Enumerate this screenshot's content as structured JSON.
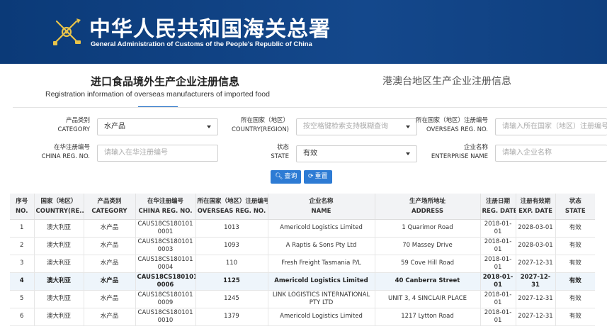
{
  "header": {
    "title_cn": "中华人民共和国海关总署",
    "title_en": "General Administration of Customs of the People's Republic of China",
    "emblem": "customs-emblem-icon",
    "bg_color": "#0e3d7a"
  },
  "tabs": {
    "active_cn": "进口食品境外生产企业注册信息",
    "active_en": "Registration information of overseas manufacturers of imported food",
    "other_cn": "港澳台地区生产企业注册信息"
  },
  "form": {
    "category": {
      "label_cn": "产品类别",
      "label_en": "CATEGORY",
      "value": "水产品"
    },
    "country": {
      "label_cn": "所在国家（地区）",
      "label_en": "COUNTRY(REGION)",
      "placeholder": "按空格键检索支持模糊查询"
    },
    "overseas_reg": {
      "label_cn": "所在国家（地区）注册编号",
      "label_en": "OVERSEAS REG. NO.",
      "placeholder": "请输入所在国家（地区）注册编号"
    },
    "china_reg": {
      "label_cn": "在华注册编号",
      "label_en": "CHINA REG. NO.",
      "placeholder": "请输入在华注册编号"
    },
    "state": {
      "label_cn": "状态",
      "label_en": "STATE",
      "value": "有效"
    },
    "enterprise": {
      "label_cn": "企业名称",
      "label_en": "ENTERPRISE NAME",
      "placeholder": "请输入企业名称"
    },
    "search_label": "查询",
    "reset_label": "重置",
    "accent_color": "#2d7bd4"
  },
  "table": {
    "headers": [
      {
        "cn": "序号",
        "en": "NO."
      },
      {
        "cn": "国家（地区）",
        "en": "COUNTRY(RE..."
      },
      {
        "cn": "产品类别",
        "en": "CATEGORY"
      },
      {
        "cn": "在华注册编号",
        "en": "CHINA REG. NO."
      },
      {
        "cn": "所在国家（地区）注册编号",
        "en": "OVERSEAS REG. NO."
      },
      {
        "cn": "企业名称",
        "en": "NAME"
      },
      {
        "cn": "生产场所地址",
        "en": "ADDRESS"
      },
      {
        "cn": "注册日期",
        "en": "REG. DATE"
      },
      {
        "cn": "注册有效期",
        "en": "EXP. DATE"
      },
      {
        "cn": "状态",
        "en": "STATE"
      }
    ],
    "rows": [
      [
        "1",
        "澳大利亚",
        "水产品",
        "CAUS18CS180101 0001",
        "1013",
        "Americold Logistics Limited",
        "1 Quarimor Road",
        "2018-01-01",
        "2028-03-01",
        "有效"
      ],
      [
        "2",
        "澳大利亚",
        "水产品",
        "CAUS18CS180101 0003",
        "1093",
        "A Raptis & Sons Pty Ltd",
        "70 Massey Drive",
        "2018-01-01",
        "2028-03-01",
        "有效"
      ],
      [
        "3",
        "澳大利亚",
        "水产品",
        "CAUS18CS180101 0004",
        "110",
        "Fresh Freight Tasmania P/L",
        "59 Cove Hill Road",
        "2018-01-01",
        "2027-12-31",
        "有效"
      ],
      [
        "4",
        "澳大利亚",
        "水产品",
        "CAUS18CS180101 0006",
        "1125",
        "Americold Logistics Limited",
        "40 Canberra Street",
        "2018-01-01",
        "2027-12-31",
        "有效"
      ],
      [
        "5",
        "澳大利亚",
        "水产品",
        "CAUS18CS180101 0009",
        "1245",
        "LINK LOGISTICS INTERNATIONAL PTY LTD",
        "UNIT 3, 4 SINCLAIR PLACE",
        "2018-01-01",
        "2027-12-31",
        "有效"
      ],
      [
        "6",
        "澳大利亚",
        "水产品",
        "CAUS18CS180101 0010",
        "1379",
        "Americold Logistics Limited",
        "1217 Lytton Road",
        "2018-01-01",
        "2027-12-31",
        "有效"
      ]
    ]
  }
}
